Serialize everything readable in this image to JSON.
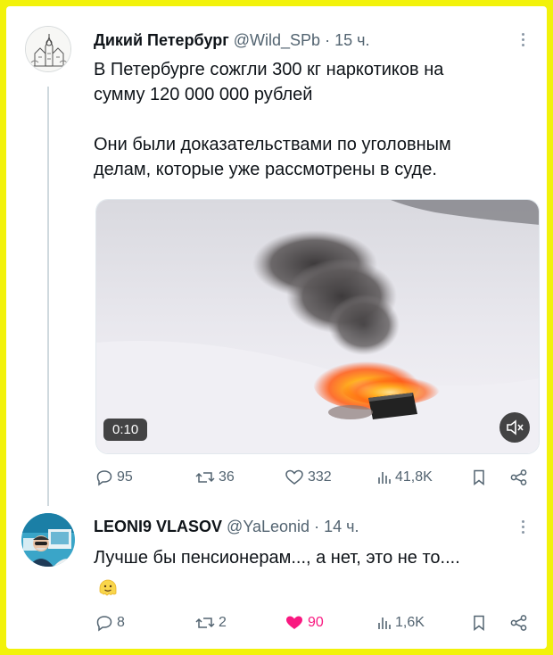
{
  "colors": {
    "frame_border": "#f2f20a",
    "text": "#0f1419",
    "muted": "#536471",
    "like_active": "#f91880"
  },
  "tweet": {
    "author_name": "Дикий Петербург",
    "handle": "@Wild_SPb",
    "separator": "·",
    "time": "15 ч.",
    "text_line1": "В Петербурге сожгли 300 кг наркотиков на",
    "text_line2": "сумму 120 000 000 рублей",
    "text_line3": "Они были доказательствами по уголовным",
    "text_line4": "делам, которые уже рассмотрены в суде.",
    "video_duration": "0:10",
    "replies": "95",
    "reposts": "36",
    "likes": "332",
    "views": "41,8K"
  },
  "reply": {
    "author_name": "LEONI9 VLASOV",
    "handle": "@YaLeonid",
    "separator": "·",
    "time": "14 ч.",
    "text": "Лучше бы пенсионерам..., а нет, это не то....",
    "emoji": "melting-face",
    "replies": "8",
    "reposts": "2",
    "likes": "90",
    "likes_active": true,
    "views": "1,6K"
  }
}
